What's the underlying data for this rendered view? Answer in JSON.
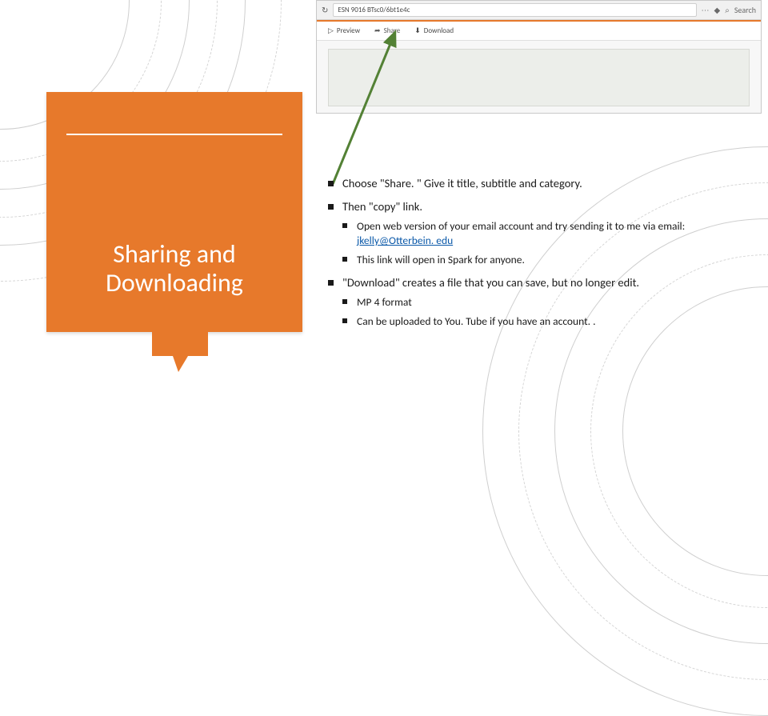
{
  "card": {
    "title_line1": "Sharing and",
    "title_line2": "Downloading"
  },
  "browser": {
    "url": "ESN 9016 BTsc0/6bt1e4c",
    "toolbar": {
      "preview": "Preview",
      "share": "Share",
      "download": "Download"
    },
    "search": "Search",
    "menu_glyph": "⋯",
    "shield_glyph": "◆",
    "mag_glyph": "⌕",
    "refresh_glyph": "↻",
    "play_glyph": "▷",
    "share_glyph": "➦",
    "download_glyph": "⬇"
  },
  "bullets": {
    "b1": "Choose \"Share. \" Give it title, subtitle and category.",
    "b2": "Then \"copy\" link.",
    "b2a_pre": "Open web version of your email account and try sending it to me via email: ",
    "b2a_link": "jkelly@Otterbein. edu",
    "b2b": "This link will open in Spark for anyone.",
    "b3": "\"Download\" creates a file that you can save, but no longer edit.",
    "b3a": "MP 4 format",
    "b3b": "Can be uploaded to You. Tube if you have an account. ."
  }
}
